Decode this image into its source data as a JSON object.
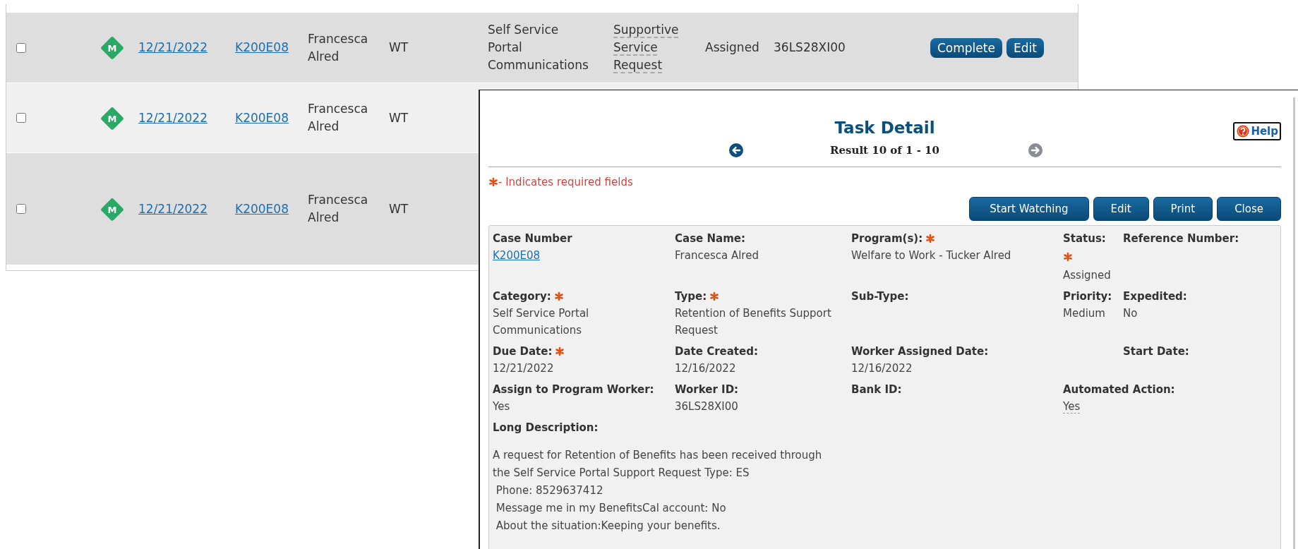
{
  "task_list": {
    "rows": [
      {
        "checked": false,
        "badge": "M",
        "due_date": "12/21/2022",
        "case_number": "K200E08",
        "name": "Francesca Alred",
        "program": "WT",
        "category": "Self Service Portal Communications",
        "type": "Supportive Service Request",
        "status": "Assigned",
        "worker_id": "36LS28XI00",
        "actions": [
          "Complete",
          "Edit"
        ]
      },
      {
        "checked": false,
        "badge": "M",
        "due_date": "12/21/2022",
        "case_number": "K200E08",
        "name": "Francesca Alred",
        "program": "WT"
      },
      {
        "checked": false,
        "badge": "M",
        "due_date": "12/21/2022",
        "case_number": "K200E08",
        "name": "Francesca Alred",
        "program": "WT"
      }
    ]
  },
  "dialog": {
    "title": "Task Detail",
    "help": "Help",
    "result": "Result 10 of 1 - 10",
    "prev_enabled": true,
    "next_enabled": false,
    "required_note": "- Indicates required fields",
    "buttons": [
      "Start Watching",
      "Edit",
      "Print",
      "Close"
    ],
    "field_rows": [
      [
        {
          "label": "Case Number",
          "value": "K200E08",
          "kind": "link",
          "required": false
        },
        {
          "label": "Case Name:",
          "value": "Francesca Alred",
          "kind": "text",
          "required": false
        },
        {
          "label": "Program(s):",
          "value": "Welfare to Work - Tucker Alred",
          "kind": "text",
          "required": true
        },
        {
          "label": "Status:",
          "value": "Assigned",
          "kind": "text",
          "required": true
        },
        {
          "label": "Reference Number:",
          "required": false
        }
      ],
      [
        {
          "label": "Category:",
          "value": "Self Service Portal Communications",
          "kind": "text",
          "required": true
        },
        {
          "label": "Type:",
          "value": "Retention of Benefits Support Request",
          "kind": "text",
          "required": true
        },
        {
          "label": "Sub-Type:",
          "required": false
        },
        {
          "label": "Priority:",
          "value": "Medium",
          "kind": "text",
          "required": false
        },
        {
          "label": "Expedited:",
          "value": "No",
          "kind": "text",
          "required": false
        }
      ],
      [
        {
          "label": "Due Date:",
          "value": "12/21/2022",
          "kind": "text",
          "required": true
        },
        {
          "label": "Date Created:",
          "value": "12/16/2022",
          "kind": "text",
          "required": false
        },
        {
          "label": "Worker Assigned Date:",
          "value": "12/16/2022",
          "kind": "text",
          "required": false
        },
        {
          "label": "Start Date:",
          "required": false
        }
      ],
      [
        {
          "label": "Assign to Program Worker:",
          "value": "Yes",
          "kind": "text",
          "required": false
        },
        {
          "label": "Worker ID:",
          "value": "36LS28XI00",
          "kind": "text",
          "required": false
        },
        {
          "label": "Bank ID:",
          "required": false
        },
        {
          "label": "Automated Action:",
          "value": "Yes",
          "kind": "tooltip",
          "required": false
        }
      ]
    ],
    "long_description": {
      "label": "Long Description:",
      "text": "A request for Retention of Benefits has been received through\nthe Self Service Portal Support Request Type: ES\n Phone: 8529637412\n Message me in my BenefitsCal account: No\n About the situation:Keeping your benefits."
    }
  }
}
